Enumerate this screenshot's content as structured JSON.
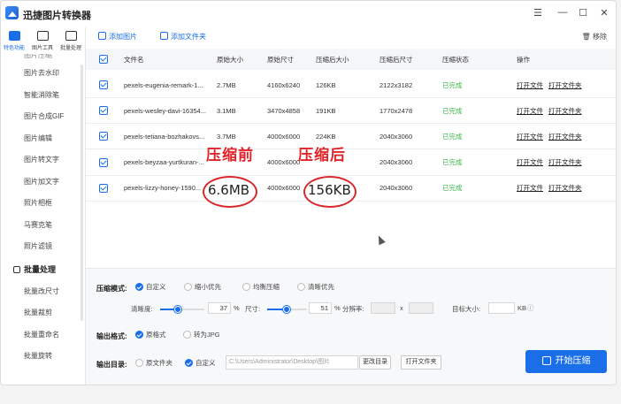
{
  "app": {
    "title": "迅捷图片转换器"
  },
  "window_controls": {
    "menu": "☰",
    "minimize": "—",
    "maximize": "☐",
    "close": "✕"
  },
  "sidebar": {
    "top_nav": [
      {
        "label": "特色功能",
        "active": true
      },
      {
        "label": "图片工具",
        "active": false
      },
      {
        "label": "批量处理",
        "active": false
      }
    ],
    "clipped_item": "图片压缩",
    "items": [
      "图片去水印",
      "智能消除笔",
      "图片合成GIF",
      "图片编辑",
      "图片转文字",
      "图片加文字",
      "照片相框",
      "马赛克笔",
      "照片滤镜"
    ],
    "section": "批量处理",
    "batch_items": [
      "批量改尺寸",
      "批量裁剪",
      "批量重命名",
      "批量旋转"
    ]
  },
  "toolbar": {
    "add_image": "添加图片",
    "add_folder": "添加文件夹",
    "remove": "移除"
  },
  "table": {
    "headers": [
      "文件名",
      "原始大小",
      "原始尺寸",
      "压缩后大小",
      "压缩后尺寸",
      "压缩状态",
      "操作"
    ],
    "rows": [
      {
        "name": "pexels-eugenia-remark-1...",
        "orig_size": "2.7MB",
        "orig_dim": "4160x6240",
        "new_size": "126KB",
        "new_dim": "2122x3182",
        "status": "已完成",
        "op1": "打开文件",
        "op2": "打开文件夹"
      },
      {
        "name": "pexels-wesley-davi-16354...",
        "orig_size": "3.1MB",
        "orig_dim": "3470x4858",
        "new_size": "191KB",
        "new_dim": "1770x2478",
        "status": "已完成",
        "op1": "打开文件",
        "op2": "打开文件夹"
      },
      {
        "name": "pexels-tetiana-bozhakovs...",
        "orig_size": "3.7MB",
        "orig_dim": "4000x6000",
        "new_size": "224KB",
        "new_dim": "2040x3060",
        "status": "已完成",
        "op1": "打开文件",
        "op2": "打开文件夹"
      },
      {
        "name": "pexels-beyzaa-yurtkuran-...",
        "orig_size": "",
        "orig_dim": "4000x6000",
        "new_size": "",
        "new_dim": "2040x3060",
        "status": "已完成",
        "op1": "打开文件",
        "op2": "打开文件夹"
      },
      {
        "name": "pexels-lizzy-honey-1590...",
        "orig_size": "",
        "orig_dim": "4000x6000",
        "new_size": "",
        "new_dim": "2040x3060",
        "status": "已完成",
        "op1": "打开文件",
        "op2": "打开文件夹"
      }
    ]
  },
  "annotation": {
    "before_label": "压缩前",
    "before_size": "6.6MB",
    "after_label": "压缩后",
    "after_size": "156KB",
    "color": "#e0242a"
  },
  "settings": {
    "mode_label": "压缩模式:",
    "modes": [
      {
        "label": "自定义",
        "selected": true
      },
      {
        "label": "缩小优先",
        "selected": false
      },
      {
        "label": "均衡压缩",
        "selected": false
      },
      {
        "label": "清晰优先",
        "selected": false
      }
    ],
    "clarity_label": "清晰度:",
    "clarity_value": "37",
    "size_label": "尺寸:",
    "size_value": "51",
    "percent": "%",
    "resolution_label": "分辨率:",
    "resolution_x": "x",
    "target_label": "目标大小:",
    "target_unit": "KB",
    "format_label": "输出格式:",
    "formats": [
      {
        "label": "原格式",
        "selected": true
      },
      {
        "label": "转为JPG",
        "selected": false
      }
    ],
    "dir_label": "输出目录:",
    "dirs": [
      {
        "label": "原文件夹",
        "selected": false
      },
      {
        "label": "自定义",
        "selected": true
      }
    ],
    "path_value": "C:\\Users\\Administrator\\Desktop\\图片",
    "change_dir": "更改目录",
    "open_folder": "打开文件夹",
    "start": "开始压缩"
  },
  "colors": {
    "accent": "#1a6fe8",
    "done": "#3bb54a"
  }
}
